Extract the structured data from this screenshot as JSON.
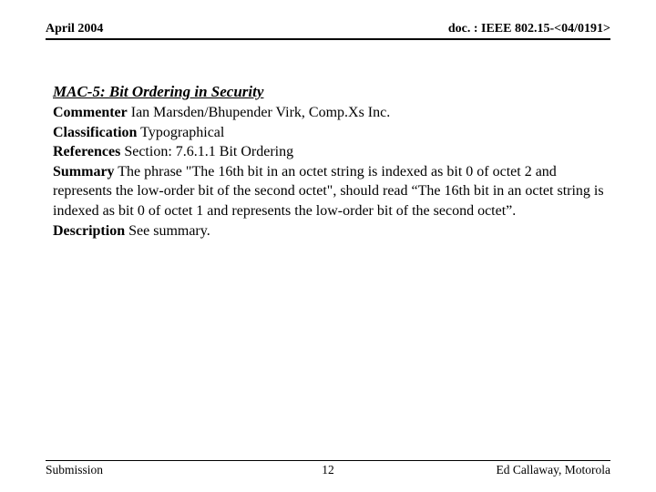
{
  "header": {
    "date": "April 2004",
    "doc_ref": "doc. : IEEE 802.15-<04/0191>"
  },
  "body": {
    "title": "MAC-5: Bit Ordering in Security",
    "commenter_label": "Commenter",
    "commenter_value": " Ian Marsden/Bhupender Virk, Comp.Xs Inc.",
    "classification_label": "Classification",
    "classification_value": " Typographical",
    "references_label": "References",
    "references_value": " Section: 7.6.1.1 Bit Ordering",
    "summary_label": "Summary",
    "summary_value": " The phrase \"The 16th bit in an octet string is indexed as bit 0 of octet 2 and represents the low-order bit of the second octet\", should read “The 16th bit in an octet string is indexed as bit 0 of octet 1 and represents the low-order bit of the second octet”.",
    "description_label": "Description",
    "description_value": " See summary."
  },
  "footer": {
    "left": "Submission",
    "center": "12",
    "right": "Ed Callaway, Motorola"
  }
}
